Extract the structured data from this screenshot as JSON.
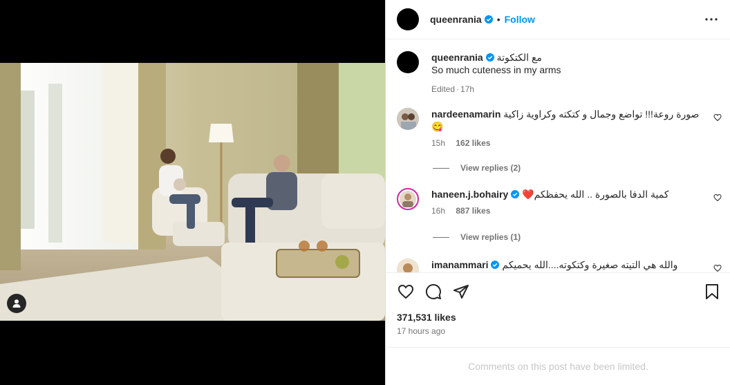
{
  "header": {
    "username": "queenrania",
    "separator": "•",
    "follow_label": "Follow"
  },
  "caption": {
    "username": "queenrania",
    "text_arabic": "مع الكتكوتة",
    "text_english": "So much cuteness in my arms",
    "edited": "Edited",
    "time": "17h"
  },
  "comments": [
    {
      "username": "nardeenamarin",
      "verified": false,
      "text": "صورة روعة!!! تواضع وجمال و كتكته وكراوية زاكية 😋",
      "time": "15h",
      "likes": "162 likes",
      "replies": "View replies (2)"
    },
    {
      "username": "haneen.j.bohairy",
      "verified": true,
      "text": "كمية الدفا بالصورة .. الله يحفظكم❤️",
      "time": "16h",
      "likes": "887 likes",
      "replies": "View replies (1)"
    },
    {
      "username": "imanammari",
      "verified": true,
      "text": "والله هي التيته صغيرة وكتكوته....الله يحميكم",
      "time": "",
      "likes": "",
      "replies": ""
    }
  ],
  "post": {
    "likes": "371,531 likes",
    "time_ago": "17 hours ago"
  },
  "footer": {
    "limited_text": "Comments on this post have been limited."
  },
  "icons": {
    "more": "more-options-icon",
    "like": "heart-icon",
    "comment": "comment-icon",
    "share": "share-icon",
    "save": "bookmark-icon",
    "tag": "user-tag-icon",
    "verified": "verified-badge-icon"
  },
  "colors": {
    "accent": "#0095f6",
    "verified": "#0095f6",
    "text": "#262626",
    "muted": "#737373"
  }
}
